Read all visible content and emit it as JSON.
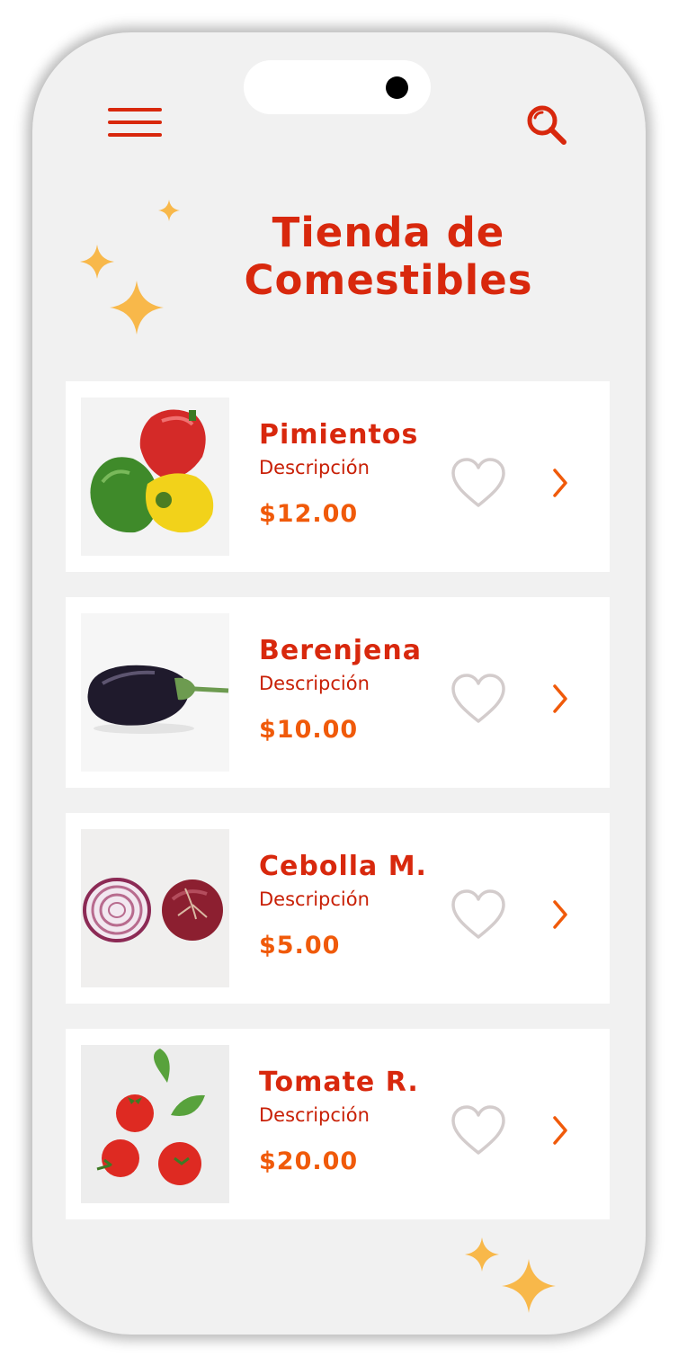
{
  "header": {
    "title_line1": "Tienda de",
    "title_line2": "Comestibles",
    "menu_icon": "hamburger-menu-icon",
    "search_icon": "search-icon"
  },
  "colors": {
    "accent_red": "#d8280d",
    "price_orange": "#f05a0a",
    "sparkle_yellow": "#f8b84a",
    "heart_gray": "#d3cccc",
    "background": "#f1f1f1"
  },
  "products": [
    {
      "name": "Pimientos",
      "description": "Descripción",
      "price": "$12.00",
      "image": "bell-peppers"
    },
    {
      "name": "Berenjena",
      "description": "Descripción",
      "price": "$10.00",
      "image": "eggplant"
    },
    {
      "name": "Cebolla M.",
      "description": "Descripción",
      "price": "$5.00",
      "image": "red-onion"
    },
    {
      "name": "Tomate R.",
      "description": "Descripción",
      "price": "$20.00",
      "image": "tomatoes-basil"
    }
  ]
}
